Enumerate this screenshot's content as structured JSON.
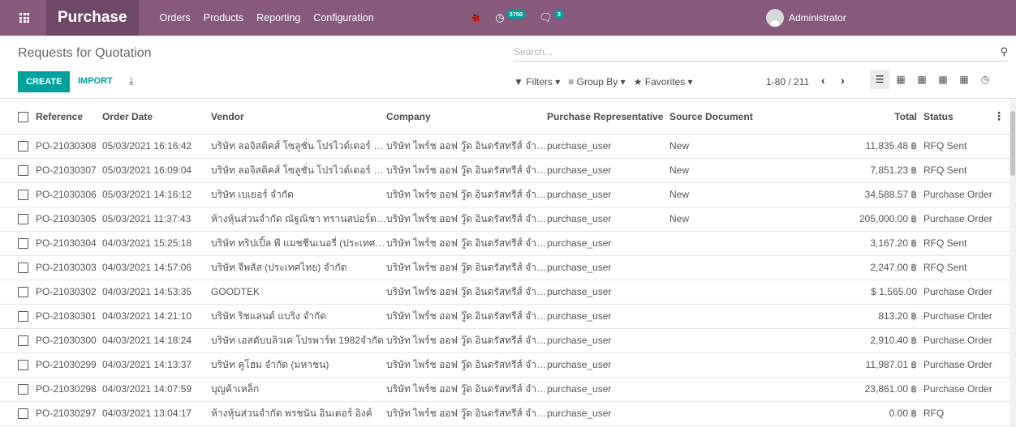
{
  "navbar": {
    "app_name": "Purchase",
    "menu": [
      "Orders",
      "Products",
      "Reporting",
      "Configuration"
    ],
    "bug_glyph": "🐞",
    "activity_badge": "3750",
    "messages_badge": "3",
    "user_name": "Administrator"
  },
  "control_panel": {
    "breadcrumb": "Requests for Quotation",
    "search_placeholder": "Search...",
    "create_label": "CREATE",
    "import_label": "IMPORT",
    "filters_label": "Filters",
    "group_by_label": "Group By",
    "favorites_label": "Favorites",
    "pager": "1-80 / 211"
  },
  "table": {
    "headers": {
      "reference": "Reference",
      "order_date": "Order Date",
      "vendor": "Vendor",
      "company": "Company",
      "representative": "Purchase Representative",
      "source": "Source Document",
      "total": "Total",
      "status": "Status"
    },
    "rows": [
      {
        "reference": "PO-21030308",
        "order_date": "05/03/2021 16:16:42",
        "vendor": "บริษัท ลอจิสติคส์ โซลูชั่น โปรไวด์เดอร์ จำกัด",
        "company": "บริษัท ไพร์ช ออฟ วู๊ด อินดรัสทรีส์ จำกัด",
        "representative": "purchase_user",
        "source": "New",
        "total": "11,835.48 ฿",
        "status": "RFQ Sent"
      },
      {
        "reference": "PO-21030307",
        "order_date": "05/03/2021 16:09:04",
        "vendor": "บริษัท ลอจิสติคส์ โซลูชั่น โปรไวด์เดอร์ จำกัด",
        "company": "บริษัท ไพร์ช ออฟ วู๊ด อินดรัสทรีส์ จำกัด",
        "representative": "purchase_user",
        "source": "New",
        "total": "7,851.23 ฿",
        "status": "RFQ Sent"
      },
      {
        "reference": "PO-21030306",
        "order_date": "05/03/2021 14:16:12",
        "vendor": "บริษัท เบเยอร์ จำกัด",
        "company": "บริษัท ไพร์ช ออฟ วู๊ด อินดรัสทรีส์ จำกัด",
        "representative": "purchase_user",
        "source": "New",
        "total": "34,588.57 ฿",
        "status": "Purchase Order"
      },
      {
        "reference": "PO-21030305",
        "order_date": "05/03/2021 11:37:43",
        "vendor": "ห้างหุ้นส่วนจำกัด ณัฐณิชา ทรานสปอร์ต แอนด์ เซอร์วิส",
        "company": "บริษัท ไพร์ช ออฟ วู๊ด อินดรัสทรีส์ จำกัด",
        "representative": "purchase_user",
        "source": "New",
        "total": "205,000.00 ฿",
        "status": "Purchase Order"
      },
      {
        "reference": "PO-21030304",
        "order_date": "04/03/2021 15:25:18",
        "vendor": "บริษัท ทริปเปิ้ล พี แมชชีนเนอรี่ (ประเทศไทย) จำกัด",
        "company": "บริษัท ไพร์ช ออฟ วู๊ด อินดรัสทรีส์ จำกัด",
        "representative": "purchase_user",
        "source": "",
        "total": "3,167.20 ฿",
        "status": "RFQ Sent"
      },
      {
        "reference": "PO-21030303",
        "order_date": "04/03/2021 14:57:06",
        "vendor": "บริษัท จีพลัส (ประเทศไทย) จำกัด",
        "company": "บริษัท ไพร์ช ออฟ วู๊ด อินดรัสทรีส์ จำกัด",
        "representative": "purchase_user",
        "source": "",
        "total": "2,247.00 ฿",
        "status": "RFQ Sent"
      },
      {
        "reference": "PO-21030302",
        "order_date": "04/03/2021 14:53:35",
        "vendor": "GOODTEK",
        "company": "บริษัท ไพร์ช ออฟ วู๊ด อินดรัสทรีส์ จำกัด",
        "representative": "purchase_user",
        "source": "",
        "total": "$ 1,565.00",
        "status": "Purchase Order"
      },
      {
        "reference": "PO-21030301",
        "order_date": "04/03/2021 14:21:10",
        "vendor": "บริษัท ริชแลนด์ แบริ่ง จำกัด",
        "company": "บริษัท ไพร์ช ออฟ วู๊ด อินดรัสทรีส์ จำกัด",
        "representative": "purchase_user",
        "source": "",
        "total": "813.20 ฿",
        "status": "Purchase Order"
      },
      {
        "reference": "PO-21030300",
        "order_date": "04/03/2021 14:18:24",
        "vendor": "บริษัท เอสดับบลิวเค โปรพาร์ท 1982จำกัด",
        "company": "บริษัท ไพร์ช ออฟ วู๊ด อินดรัสทรีส์ จำกัด",
        "representative": "purchase_user",
        "source": "",
        "total": "2,910.40 ฿",
        "status": "Purchase Order"
      },
      {
        "reference": "PO-21030299",
        "order_date": "04/03/2021 14:13:37",
        "vendor": "บริษัท คูโฮม จำกัด (มหาชน)",
        "company": "บริษัท ไพร์ช ออฟ วู๊ด อินดรัสทรีส์ จำกัด",
        "representative": "purchase_user",
        "source": "",
        "total": "11,987.01 ฿",
        "status": "Purchase Order"
      },
      {
        "reference": "PO-21030298",
        "order_date": "04/03/2021 14:07:59",
        "vendor": "บุญค้าเหล็ก",
        "company": "บริษัท ไพร์ช ออฟ วู๊ด อินดรัสทรีส์ จำกัด",
        "representative": "purchase_user",
        "source": "",
        "total": "23,861.00 ฿",
        "status": "Purchase Order"
      },
      {
        "reference": "PO-21030297",
        "order_date": "04/03/2021 13:04:17",
        "vendor": "ห้างหุ้นส่วนจำกัด พรชนัน อินเตอร์ อิงค์",
        "company": "บริษัท ไพร์ช ออฟ วู๊ด อินดรัสทรีส์ จำกัด",
        "representative": "purchase_user",
        "source": "",
        "total": "0.00 ฿",
        "status": "RFQ"
      }
    ]
  }
}
